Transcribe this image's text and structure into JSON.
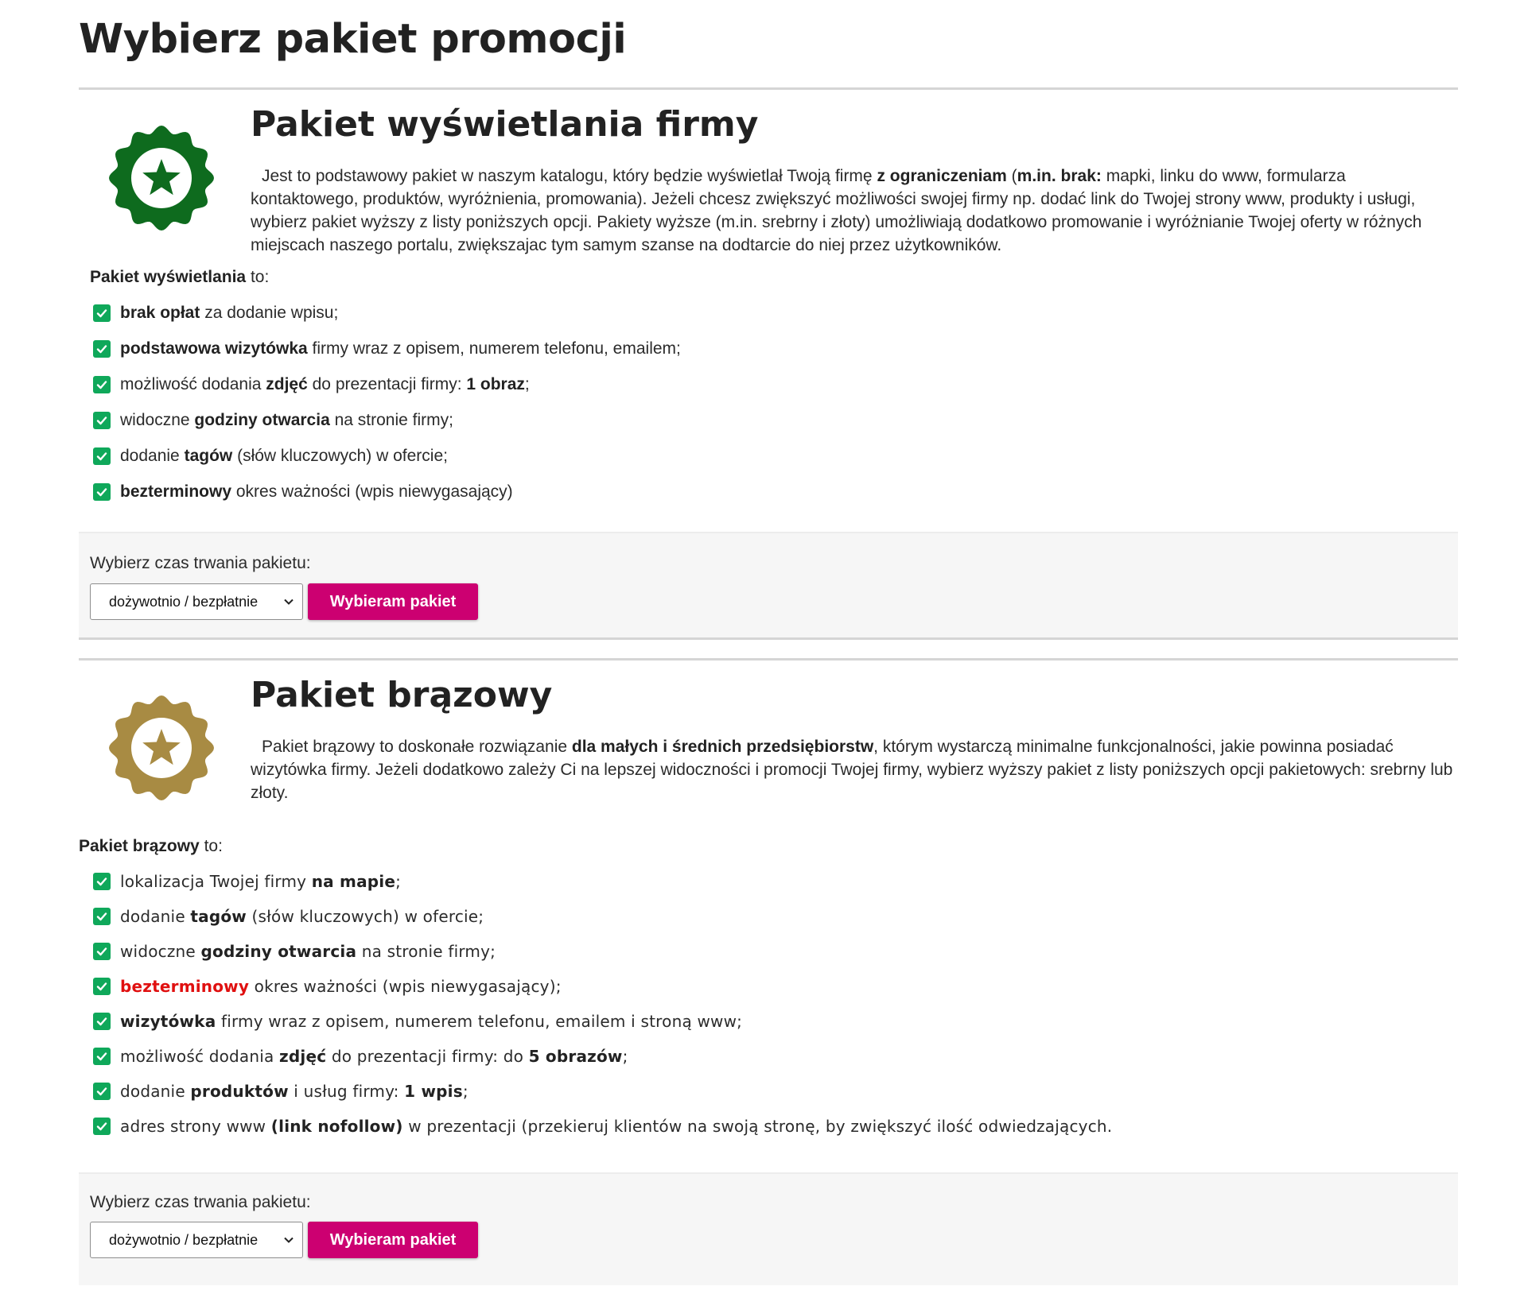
{
  "page": {
    "title": "Wybierz pakiet promocji"
  },
  "colors": {
    "accent_button": "#cc0071",
    "check_green": "#0fa85a",
    "badge_green": "#0e6b1e",
    "badge_bronze": "#a88b43",
    "highlight_red": "#e01010"
  },
  "packages": [
    {
      "title": "Pakiet wyświetlania firmy",
      "badge_icon": "green-star-badge-icon",
      "description": [
        {
          "t": "Jest to podstawowy pakiet w naszym katalogu, który będzie wyświetlał Twoją firmę "
        },
        {
          "t": "z ograniczeniam",
          "b": true
        },
        {
          "t": " ("
        },
        {
          "t": "m.in. brak:",
          "b": true
        },
        {
          "t": " mapki, linku do www, formularza kontaktowego, produktów, wyróżnienia, promowania). Jeżeli chcesz zwiększyć możliwości swojej firmy np. dodać link do Twojej strony www, produkty i usługi, wybierz pakiet wyższy z listy poniższych opcji. Pakiety wyższe (m.in. srebrny i złoty) umożliwiają dodatkowo promowanie i wyróżnianie Twojej oferty w różnych miejscach naszego portalu, zwiększajac tym samym szanse na dodtarcie do niej przez użytkowników."
        }
      ],
      "features_intro": [
        {
          "t": "Pakiet wyświetlania",
          "b": true
        },
        {
          "t": " to:"
        }
      ],
      "features": [
        [
          {
            "t": "brak opłat",
            "b": true
          },
          {
            "t": " za dodanie wpisu;"
          }
        ],
        [
          {
            "t": "podstawowa wizytówka",
            "b": true
          },
          {
            "t": " firmy wraz z opisem, numerem telefonu, emailem;"
          }
        ],
        [
          {
            "t": "możliwość dodania "
          },
          {
            "t": "zdjęć",
            "b": true
          },
          {
            "t": " do prezentacji firmy: "
          },
          {
            "t": "1 obraz",
            "b": true
          },
          {
            "t": ";"
          }
        ],
        [
          {
            "t": "widoczne "
          },
          {
            "t": "godziny otwarcia",
            "b": true
          },
          {
            "t": " na stronie firmy;"
          }
        ],
        [
          {
            "t": "dodanie "
          },
          {
            "t": "tagów",
            "b": true
          },
          {
            "t": " (słów kluczowych) w ofercie;"
          }
        ],
        [
          {
            "t": "bezterminowy",
            "b": true
          },
          {
            "t": " okres ważności (wpis niewygasający)"
          }
        ]
      ],
      "duration_label": "Wybierz czas trwania pakietu:",
      "duration_selected": "dożywotnio / bezpłatnie",
      "button_label": "Wybieram pakiet"
    },
    {
      "title": "Pakiet brązowy",
      "badge_icon": "bronze-star-badge-icon",
      "description": [
        {
          "t": "Pakiet brązowy to doskonałe rozwiązanie "
        },
        {
          "t": "dla małych i średnich przedsiębiorstw",
          "b": true
        },
        {
          "t": ", którym wystarczą minimalne funkcjonalności, jakie powinna posiadać wizytówka firmy. Jeżeli dodatkowo zależy Ci na lepszej widoczności i promocji Twojej firmy, wybierz wyższy pakiet z listy poniższych opcji pakietowych: srebrny lub złoty."
        }
      ],
      "features_intro": [
        {
          "t": "Pakiet brązowy",
          "b": true
        },
        {
          "t": " to:"
        }
      ],
      "features": [
        [
          {
            "t": "lokalizacja Twojej firmy "
          },
          {
            "t": "na mapie",
            "b": true
          },
          {
            "t": ";"
          }
        ],
        [
          {
            "t": "dodanie "
          },
          {
            "t": "tagów",
            "b": true
          },
          {
            "t": " (słów kluczowych) w ofercie;"
          }
        ],
        [
          {
            "t": "widoczne "
          },
          {
            "t": "godziny otwarcia",
            "b": true
          },
          {
            "t": " na stronie firmy;"
          }
        ],
        [
          {
            "t": "bezterminowy",
            "b": true,
            "red": true
          },
          {
            "t": " okres ważności (wpis niewygasający);"
          }
        ],
        [
          {
            "t": "wizytówka",
            "b": true
          },
          {
            "t": " firmy wraz z opisem, numerem telefonu, emailem i stroną www;"
          }
        ],
        [
          {
            "t": "możliwość dodania "
          },
          {
            "t": "zdjęć",
            "b": true
          },
          {
            "t": " do prezentacji firmy: do "
          },
          {
            "t": "5 obrazów",
            "b": true
          },
          {
            "t": ";"
          }
        ],
        [
          {
            "t": "dodanie "
          },
          {
            "t": "produktów",
            "b": true
          },
          {
            "t": " i usług firmy: "
          },
          {
            "t": "1 wpis",
            "b": true
          },
          {
            "t": ";"
          }
        ],
        [
          {
            "t": "adres strony www "
          },
          {
            "t": "(link nofollow)",
            "b": true
          },
          {
            "t": " w prezentacji (przekieruj klientów na swoją stronę, by zwiększyć ilość odwiedzających."
          }
        ]
      ],
      "duration_label": "Wybierz czas trwania pakietu:",
      "duration_selected": "dożywotnio / bezpłatnie",
      "button_label": "Wybieram pakiet"
    }
  ]
}
